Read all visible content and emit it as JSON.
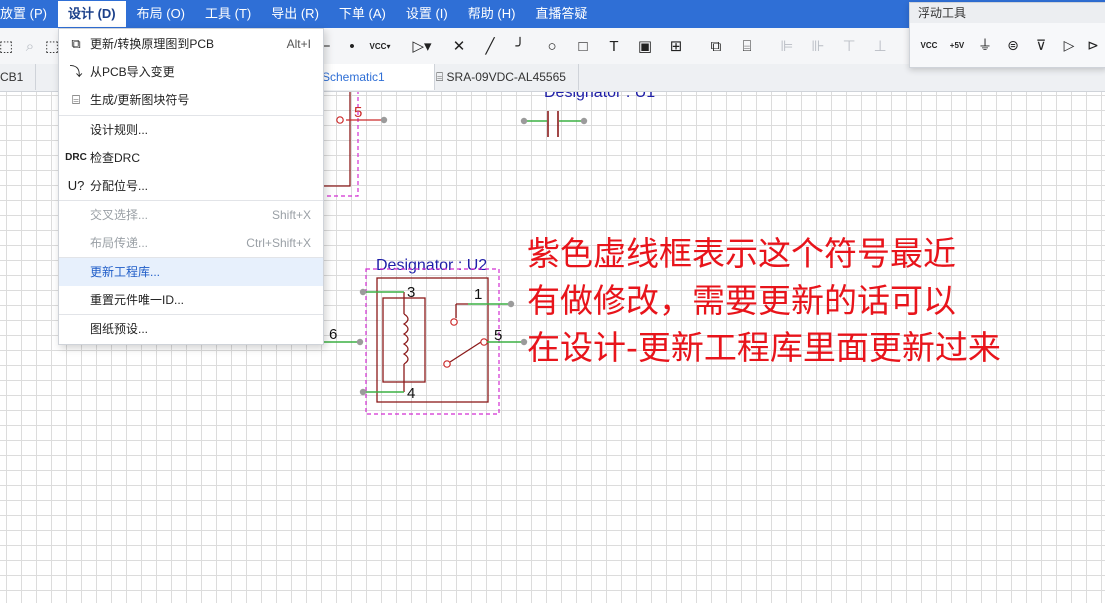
{
  "menubar": {
    "items": [
      "放置 (P)",
      "设计 (D)",
      "布局 (O)",
      "工具 (T)",
      "导出 (R)",
      "下单 (A)",
      "设置 (I)",
      "帮助 (H)",
      "直播答疑"
    ],
    "active_index": 1,
    "place_label": "放置 (P)",
    "design_label": "设计 (D)",
    "layout_label": "布局 (O)",
    "tools_label": "工具 (T)",
    "export_label": "导出 (R)",
    "order_label": "下单 (A)",
    "settings_label": "设置 (I)",
    "help_label": "帮助 (H)",
    "live_label": "直播答疑"
  },
  "tabs": {
    "pcb_label": "CB1",
    "schematic_label": "Schematic1",
    "symbol_label": "SRA-09VDC-AL45565"
  },
  "design_menu": {
    "items": [
      {
        "label": "更新/转换原理图到PCB",
        "shortcut": "Alt+I",
        "icon": "update-pcb-icon"
      },
      {
        "label": "从PCB导入变更",
        "shortcut": "",
        "icon": "import-from-pcb-icon"
      },
      {
        "label": "生成/更新图块符号",
        "shortcut": "",
        "icon": "generate-block-symbol-icon"
      },
      {
        "label": "设计规则...",
        "shortcut": "",
        "icon": ""
      },
      {
        "label": "检查DRC",
        "shortcut": "",
        "icon": "drc-icon",
        "icon_text": "DRC"
      },
      {
        "label": "分配位号...",
        "shortcut": "",
        "icon": "annotate-icon",
        "icon_text": "U?"
      },
      {
        "label": "交叉选择...",
        "shortcut": "Shift+X",
        "icon": "",
        "disabled": true
      },
      {
        "label": "布局传递...",
        "shortcut": "Ctrl+Shift+X",
        "icon": "",
        "disabled": true
      },
      {
        "label": "更新工程库...",
        "shortcut": "",
        "icon": "",
        "hovered": true
      },
      {
        "label": "重置元件唯一ID...",
        "shortcut": "",
        "icon": ""
      },
      {
        "label": "图纸预设...",
        "shortcut": "",
        "icon": ""
      }
    ]
  },
  "floating_tools": {
    "title": "浮动工具",
    "vcc_label": "VCC",
    "plus5v_label": "+5V"
  },
  "toolbar": {
    "vcc_label": "VCC"
  },
  "schematic": {
    "u1_designator": "Designator : U1",
    "u2_designator": "Designator : U2",
    "upper_pin_number": "5",
    "u2_pin_3": "3",
    "u2_pin_1": "1",
    "u2_pin_6": "6",
    "u2_pin_5": "5",
    "u2_pin_4": "4"
  },
  "annotation": {
    "line1": "紫色虚线框表示这个符号最近",
    "line2": "有做修改，需要更新的话可以",
    "line3": "在设计-更新工程库里面更新过来",
    "color": "#e8141b"
  },
  "colors": {
    "menubar": "#2f6fd6",
    "symbol_outline": "#8b1a1a",
    "wire_pin": "#3cb043",
    "dashed_frame": "#d22ed2",
    "designator_text": "#1f1fa8"
  }
}
